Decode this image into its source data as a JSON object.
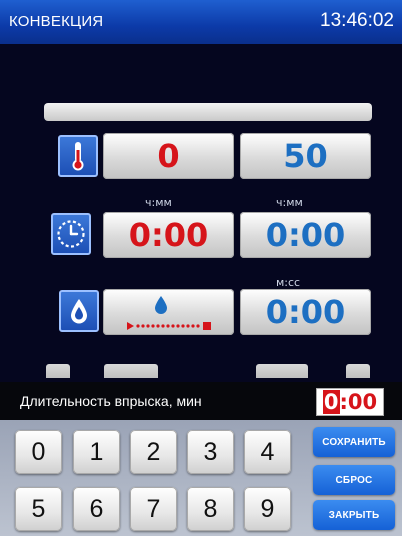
{
  "header": {
    "mode": "КОНВЕКЦИЯ",
    "time": "13:46:02"
  },
  "rows": {
    "temperature": {
      "icon": "thermometer-icon",
      "current": "0",
      "target": "50"
    },
    "time": {
      "icon": "clock-icon",
      "unit_left": "ч:мм",
      "unit_right": "ч:мм",
      "current": "0:00",
      "target": "0:00"
    },
    "steam": {
      "icon": "water-drop-icon",
      "unit_right": "м:сс",
      "target": "0:00"
    }
  },
  "editor": {
    "label": "Длительность впрыска, мин",
    "value_first": "0",
    "value_rest": ":00"
  },
  "keypad": {
    "keys": [
      "0",
      "1",
      "2",
      "3",
      "4",
      "5",
      "6",
      "7",
      "8",
      "9"
    ]
  },
  "actions": {
    "save": "СОХРАНИТЬ",
    "reset": "СБРОС",
    "close": "ЗАКРЫТЬ"
  },
  "colors": {
    "accent": "#1561d6",
    "value_red": "#d6141a",
    "value_blue": "#1d6fc2"
  }
}
